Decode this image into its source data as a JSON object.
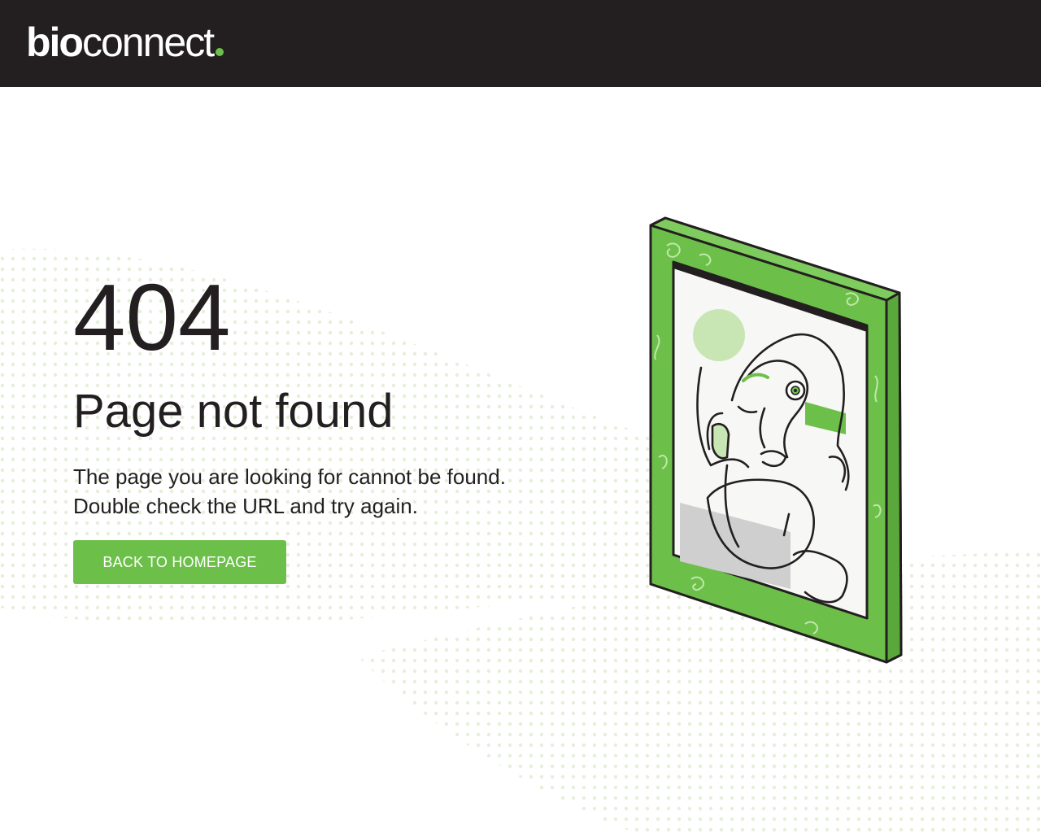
{
  "brand": {
    "logo_bold": "bio",
    "logo_light": "connect",
    "accent": "#6cc04a",
    "header_bg": "#231f20"
  },
  "error": {
    "code": "404",
    "title": "Page not found",
    "message_line1": "The page you are looking for cannot be found.",
    "message_line2": "Double check the URL and try again."
  },
  "actions": {
    "home_button_label": "BACK TO HOMEPAGE"
  },
  "illustration": {
    "icon": "framed-portrait-illustration"
  }
}
